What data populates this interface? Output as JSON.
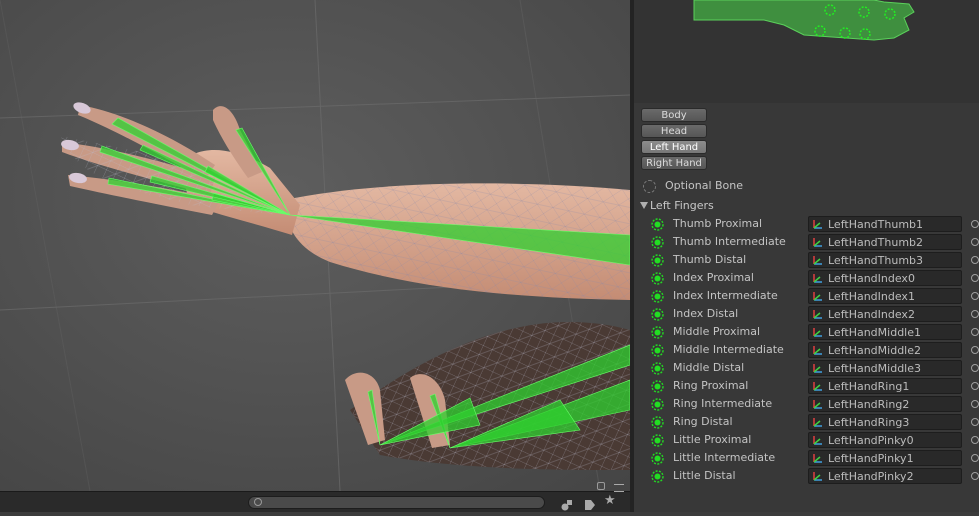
{
  "body_parts": [
    {
      "label": "Body",
      "active": false
    },
    {
      "label": "Head",
      "active": false
    },
    {
      "label": "Left Hand",
      "active": true
    },
    {
      "label": "Right Hand",
      "active": false
    }
  ],
  "optional_bone_label": "Optional Bone",
  "group_label": "Left Fingers",
  "bones": [
    {
      "label": "Thumb Proximal",
      "value": "LeftHandThumb1"
    },
    {
      "label": "Thumb Intermediate",
      "value": "LeftHandThumb2"
    },
    {
      "label": "Thumb Distal",
      "value": "LeftHandThumb3"
    },
    {
      "label": "Index Proximal",
      "value": "LeftHandIndex0"
    },
    {
      "label": "Index Intermediate",
      "value": "LeftHandIndex1"
    },
    {
      "label": "Index Distal",
      "value": "LeftHandIndex2"
    },
    {
      "label": "Middle Proximal",
      "value": "LeftHandMiddle1"
    },
    {
      "label": "Middle Intermediate",
      "value": "LeftHandMiddle2"
    },
    {
      "label": "Middle Distal",
      "value": "LeftHandMiddle3"
    },
    {
      "label": "Ring Proximal",
      "value": "LeftHandRing1"
    },
    {
      "label": "Ring Intermediate",
      "value": "LeftHandRing2"
    },
    {
      "label": "Ring Distal",
      "value": "LeftHandRing3"
    },
    {
      "label": "Little Proximal",
      "value": "LeftHandPinky0"
    },
    {
      "label": "Little Intermediate",
      "value": "LeftHandPinky1"
    },
    {
      "label": "Little Distal",
      "value": "LeftHandPinky2"
    }
  ],
  "colors": {
    "bone_green": "#22cc22",
    "accent": "#3f8f3f"
  },
  "icons": {
    "search": "search-icon",
    "object_field": "transform-icon",
    "picker": "object-picker-icon"
  }
}
